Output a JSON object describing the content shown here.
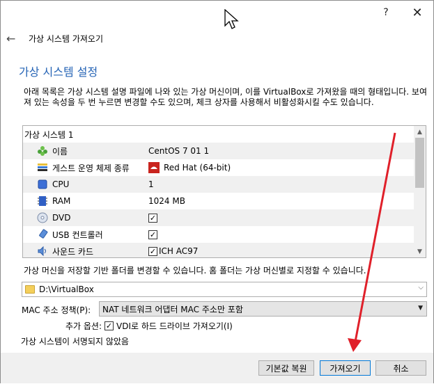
{
  "titlebar": {
    "help": "?",
    "close": "✕"
  },
  "nav": {
    "back": "←",
    "title": "가상 시스템 가져오기"
  },
  "heading": "가상 시스템 설정",
  "description": "아래 목록은 가상 시스템 설명 파일에 나와 있는 가상 머신이며, 이를 VirtualBox로 가져왔을 때의 형태입니다. 보여져 있는 속성을 두 번 누르면 변경할 수도 있으며, 체크 상자를 사용해서 비활성화시킬 수도 있습니다.",
  "tree": {
    "group": "가상 시스템 1",
    "rows": [
      {
        "icon": "name-icon",
        "label": "이름",
        "value": "CentOS 7 01 1",
        "checkbox": false
      },
      {
        "icon": "guest-os-icon",
        "label": "게스트 운영 체제 종류",
        "value": "Red Hat (64-bit)",
        "checkbox": false
      },
      {
        "icon": "cpu-icon",
        "label": "CPU",
        "value": "1",
        "checkbox": false
      },
      {
        "icon": "ram-icon",
        "label": "RAM",
        "value": "1024 MB",
        "checkbox": false
      },
      {
        "icon": "dvd-icon",
        "label": "DVD",
        "value": "",
        "checkbox": true
      },
      {
        "icon": "usb-icon",
        "label": "USB 컨트롤러",
        "value": "",
        "checkbox": true
      },
      {
        "icon": "sound-icon",
        "label": "사운드 카드",
        "value": "ICH AC97",
        "checkbox": true
      }
    ]
  },
  "hint": "가상 머신을 저장할 기반 폴더를 변경할 수 있습니다. 홈 폴더는 가상 머신별로 지정할 수 있습니다.",
  "folder": {
    "value": "D:\\VirtualBox"
  },
  "mac_policy": {
    "label": "MAC 주소 정책(P):",
    "value": "NAT 네트워크 어댑터 MAC 주소만 포함"
  },
  "extra_options": {
    "label": "추가 옵션:",
    "checkbox_label": "VDI로 하드 드라이브 가져오기(I)",
    "checked": true
  },
  "unsigned": "가상 시스템이 서명되지 않았음",
  "buttons": {
    "restore": "기본값 복원",
    "import": "가져오기",
    "cancel": "취소"
  },
  "colors": {
    "accent": "#2463b5",
    "annotation": "#e0202a"
  }
}
